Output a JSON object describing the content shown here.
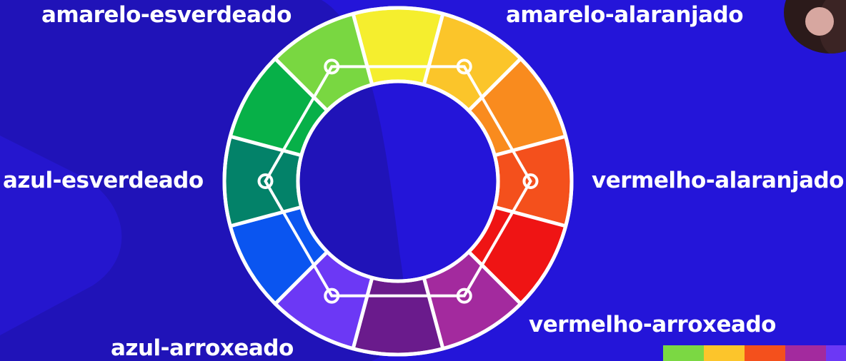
{
  "labels": {
    "yellow_green": "amarelo-esverdeado",
    "yellow_orange": "amarelo-alaranjado",
    "blue_green": "azul-esverdeado",
    "red_orange": "vermelho-alaranjado",
    "red_purple": "vermelho-arroxeado",
    "blue_purple": "azul-arroxeado"
  },
  "wheel": {
    "segments": [
      {
        "name": "yellow",
        "color": "#f5ee2e"
      },
      {
        "name": "yellow-orange",
        "color": "#fbc52a"
      },
      {
        "name": "orange",
        "color": "#f98b1e"
      },
      {
        "name": "red-orange",
        "color": "#f4501c"
      },
      {
        "name": "red",
        "color": "#ef1414"
      },
      {
        "name": "red-purple",
        "color": "#a32a9e"
      },
      {
        "name": "purple",
        "color": "#6a1b8c"
      },
      {
        "name": "blue-purple",
        "color": "#6c38f5"
      },
      {
        "name": "blue",
        "color": "#0a55f0"
      },
      {
        "name": "blue-green",
        "color": "#038269"
      },
      {
        "name": "green",
        "color": "#07b048"
      },
      {
        "name": "yellow-green",
        "color": "#79d741"
      }
    ],
    "hexagon_vertices": [
      "yellow-green",
      "yellow-orange",
      "red-orange",
      "red-purple",
      "blue-purple",
      "blue-green"
    ]
  },
  "colors": {
    "background": "#2415d9",
    "background_dark": "#1f0fb0",
    "divider": "#ffffff"
  },
  "color_strip": [
    "#7bd843",
    "#fcc52b",
    "#f4501c",
    "#a32a9e",
    "#6c38f5"
  ]
}
